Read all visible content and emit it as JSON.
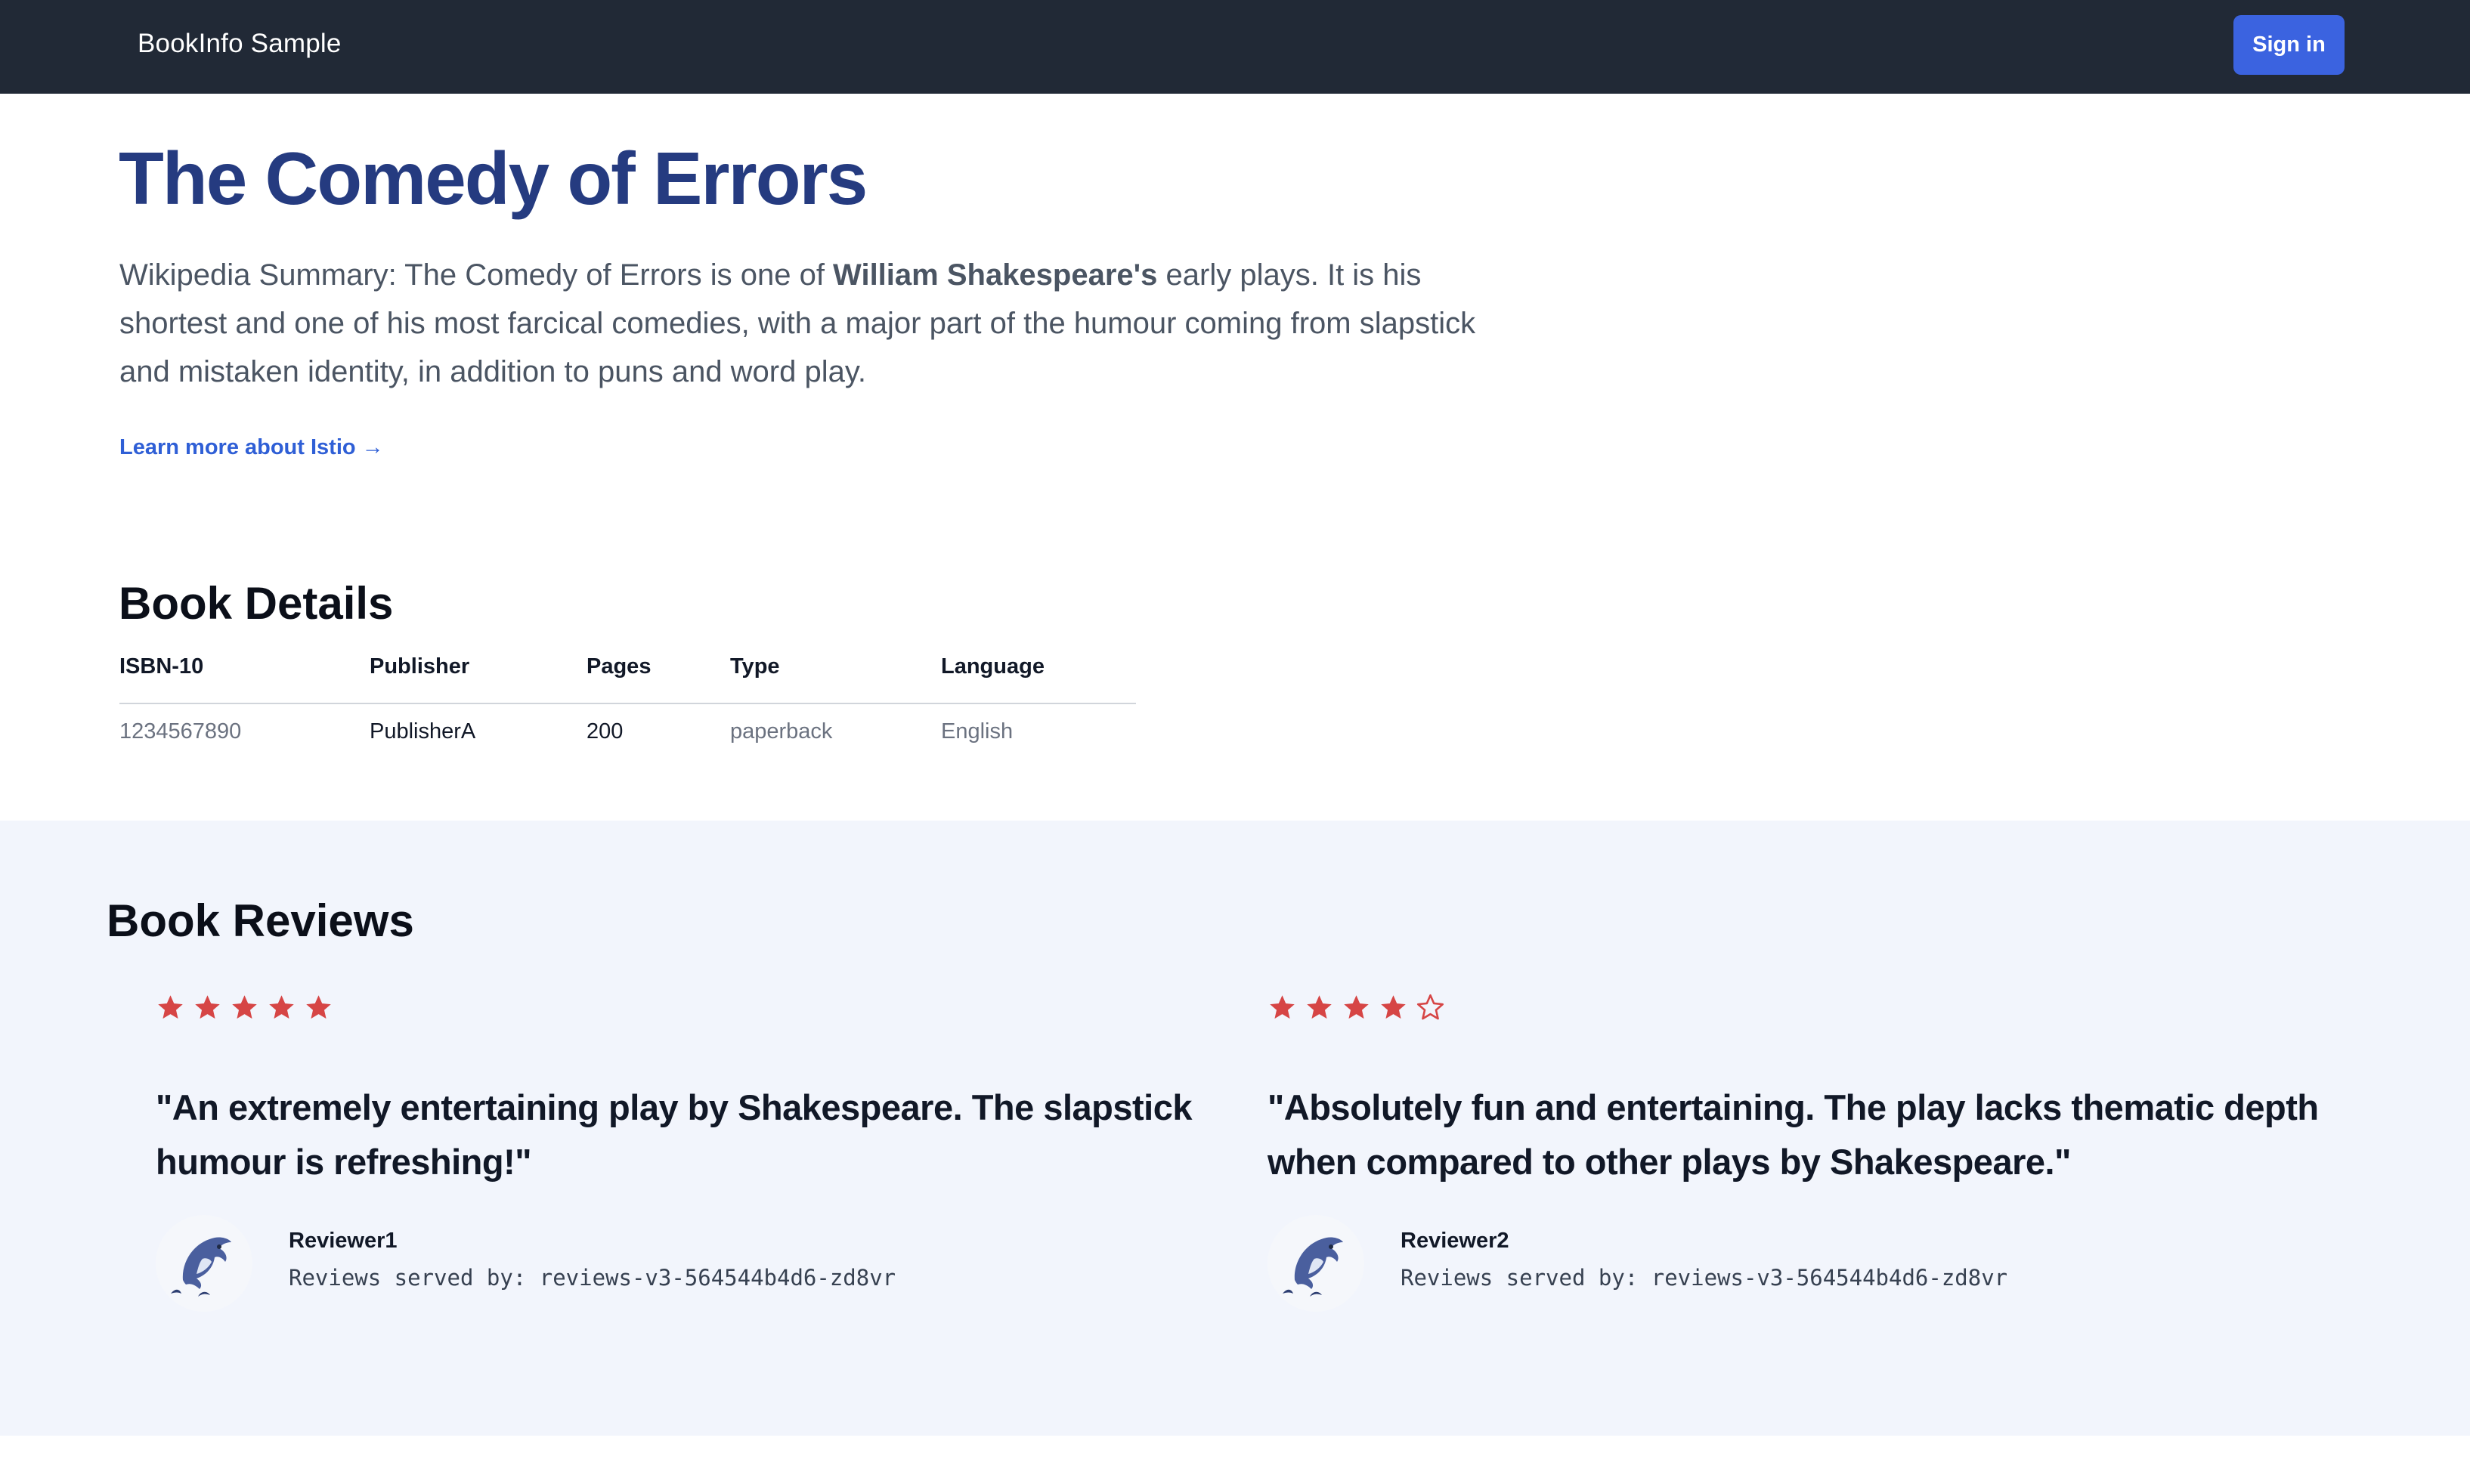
{
  "navbar": {
    "brand": "BookInfo Sample",
    "signin_label": "Sign in"
  },
  "hero": {
    "title": "The Comedy of Errors",
    "summary_prefix": "Wikipedia Summary: The Comedy of Errors is one of ",
    "summary_bold": "William Shakespeare's",
    "summary_suffix": " early plays. It is his shortest and one of his most farcical comedies, with a major part of the humour coming from slapstick and mistaken identity, in addition to puns and word play.",
    "learn_more": "Learn more about Istio →"
  },
  "details": {
    "title": "Book Details",
    "headers": [
      "ISBN-10",
      "Publisher",
      "Pages",
      "Type",
      "Language"
    ],
    "row": [
      "1234567890",
      "PublisherA",
      "200",
      "paperback",
      "English"
    ]
  },
  "reviews": {
    "title": "Book Reviews",
    "star_color": "#d64545",
    "items": [
      {
        "rating": 5,
        "quote": "\"An extremely entertaining play by Shakespeare. The slapstick humour is refreshing!\"",
        "reviewer": "Reviewer1",
        "served_by": "Reviews served by: reviews-v3-564544b4d6-zd8vr",
        "avatar_icon": "dolphin-icon"
      },
      {
        "rating": 4,
        "quote": "\"Absolutely fun and entertaining. The play lacks thematic depth when compared to other plays by Shakespeare.\"",
        "reviewer": "Reviewer2",
        "served_by": "Reviews served by: reviews-v3-564544b4d6-zd8vr",
        "avatar_icon": "dolphin-icon"
      }
    ]
  },
  "colors": {
    "navbar_bg": "#212936",
    "accent": "#3b63e0",
    "title": "#253b80",
    "reviews_bg": "#f2f5fc"
  }
}
